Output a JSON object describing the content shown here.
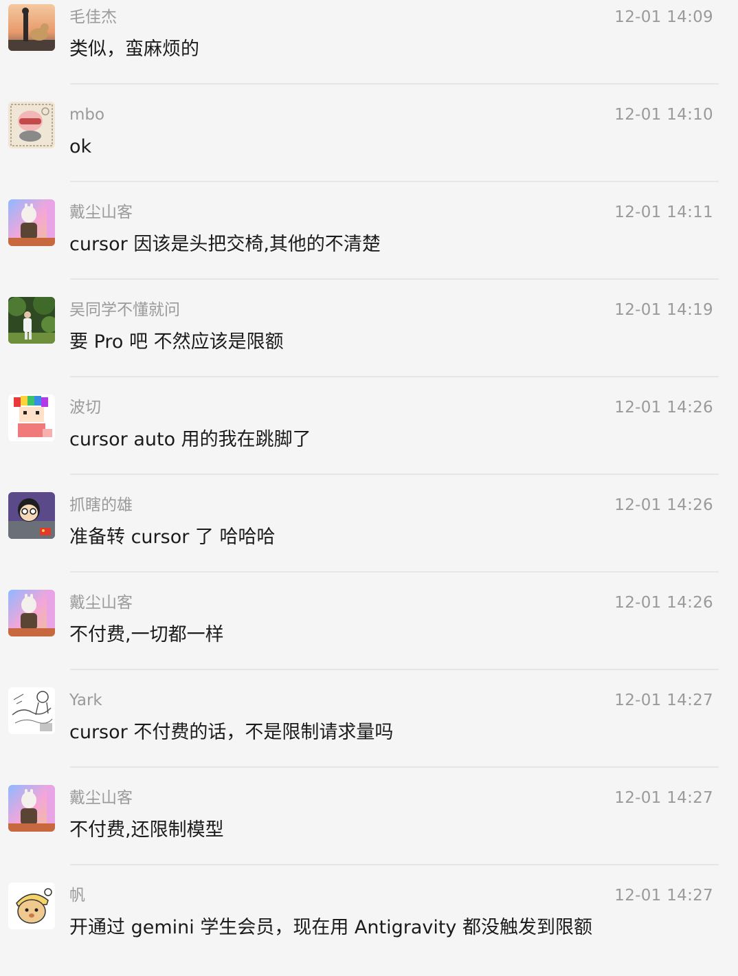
{
  "messages": [
    {
      "sender": "毛佳杰",
      "time": "12-01 14:09",
      "text": "类似，蛮麻烦的",
      "avatar": "avatar-boy-dog"
    },
    {
      "sender": "mbo",
      "time": "12-01 14:10",
      "text": "ok",
      "avatar": "avatar-pig-stamp"
    },
    {
      "sender": "戴尘山客",
      "time": "12-01 14:11",
      "text": "cursor 因该是头把交椅,其他的不清楚",
      "avatar": "avatar-rabbit-warrior"
    },
    {
      "sender": "吴同学不懂就问",
      "time": "12-01 14:19",
      "text": "要 Pro 吧  不然应该是限额",
      "avatar": "avatar-person-forest"
    },
    {
      "sender": "波切",
      "time": "12-01 14:26",
      "text": "cursor auto 用的我在跳脚了",
      "avatar": "avatar-pixel-rainbow"
    },
    {
      "sender": "抓瞎的雄",
      "time": "12-01 14:26",
      "text": "准备转 cursor 了 哈哈哈",
      "avatar": "avatar-cartoon-boy"
    },
    {
      "sender": "戴尘山客",
      "time": "12-01 14:26",
      "text": "不付费,一切都一样",
      "avatar": "avatar-rabbit-warrior"
    },
    {
      "sender": "Yark",
      "time": "12-01 14:27",
      "text": "cursor 不付费的话，不是限制请求量吗",
      "avatar": "avatar-sketch"
    },
    {
      "sender": "戴尘山客",
      "time": "12-01 14:27",
      "text": "不付费,还限制模型",
      "avatar": "avatar-rabbit-warrior"
    },
    {
      "sender": "帆",
      "time": "12-01 14:27",
      "text": "开通过 gemini 学生会员，现在用 Antigravity 都没触发到限额",
      "avatar": "avatar-cartoon-bear"
    }
  ]
}
